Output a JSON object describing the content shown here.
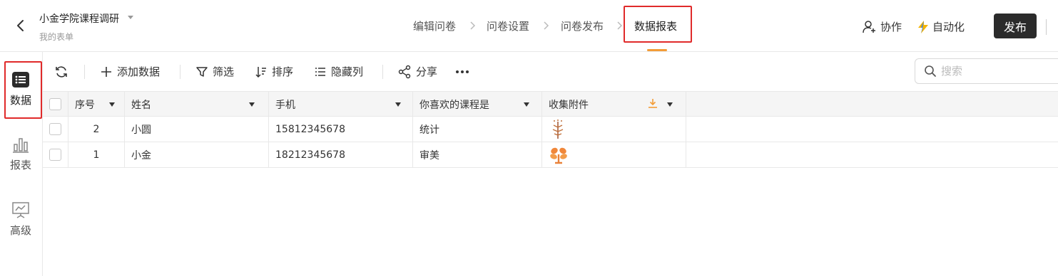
{
  "header": {
    "title": "小金学院课程调研",
    "subtitle": "我的表单",
    "steps": [
      "编辑问卷",
      "问卷设置",
      "问卷发布",
      "数据报表"
    ],
    "collab_label": "协作",
    "auto_label": "自动化",
    "publish_label": "发布",
    "accent_color": "#f39c37",
    "highlight_color": "#e02a2a"
  },
  "sidebar": {
    "items": [
      {
        "label": "数据",
        "icon": "list-icon"
      },
      {
        "label": "报表",
        "icon": "bar-chart-icon"
      },
      {
        "label": "高级",
        "icon": "presentation-icon"
      }
    ]
  },
  "toolbar": {
    "refresh_icon": "refresh-icon",
    "add_label": "添加数据",
    "filter_label": "筛选",
    "sort_label": "排序",
    "hide_label": "隐藏列",
    "share_label": "分享",
    "more_icon": "more-icon",
    "search_placeholder": "搜索"
  },
  "table": {
    "columns": [
      "序号",
      "姓名",
      "手机",
      "你喜欢的课程是",
      "收集附件"
    ],
    "rows": [
      {
        "seq": "2",
        "name": "小圆",
        "phone": "15812345678",
        "course": "统计",
        "attachment": "image-thumbnail"
      },
      {
        "seq": "1",
        "name": "小金",
        "phone": "18212345678",
        "course": "审美",
        "attachment": "image-thumbnail"
      }
    ]
  }
}
